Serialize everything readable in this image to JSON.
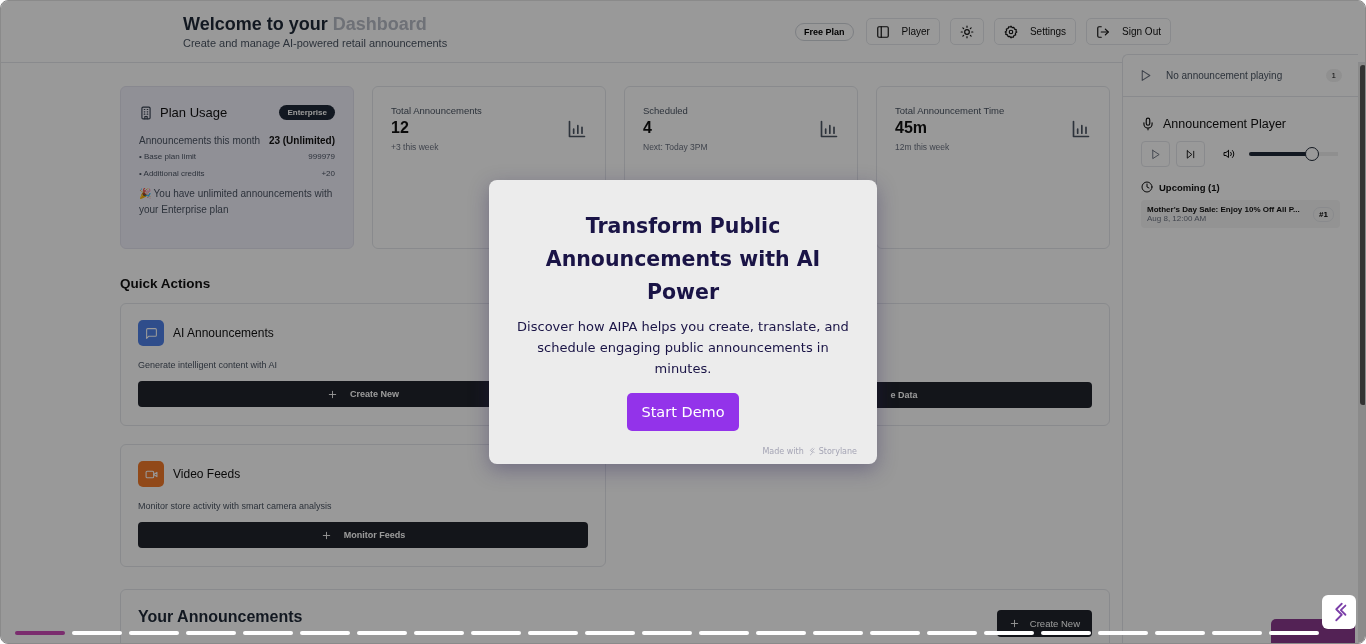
{
  "header": {
    "title_lead": "Welcome to your ",
    "title_tail": "Dashboard",
    "subtitle": "Create and manage AI-powered retail announcements",
    "plan_badge": "Free Plan",
    "buttons": [
      {
        "kind": "player",
        "label": "Player"
      },
      {
        "kind": "theme"
      },
      {
        "kind": "settings",
        "label": "Settings"
      },
      {
        "kind": "signout",
        "label": "Sign Out"
      }
    ]
  },
  "plan_usage": {
    "title": "Plan Usage",
    "badge": "Enterprise",
    "rows": [
      {
        "kind": "main",
        "label": "Announcements this month",
        "value": "23 (Unlimited)"
      },
      {
        "kind": "sub",
        "label": "• Base plan limit",
        "value": "999979"
      },
      {
        "kind": "sub",
        "label": "• Additional credits",
        "value": "+20"
      }
    ],
    "note": "🎉 You have unlimited announcements with your Enterprise plan"
  },
  "stats": [
    {
      "label": "Total Announcements",
      "value": "12",
      "detail": "+3 this week"
    },
    {
      "label": "Scheduled",
      "value": "4",
      "detail": "Next: Today 3PM"
    },
    {
      "label": "Total Announcement Time",
      "value": "45m",
      "detail": "12m this week"
    }
  ],
  "quick_actions": {
    "title": "Quick Actions",
    "cards": [
      {
        "kind": "chat",
        "title": "AI Announcements",
        "description": "Generate intelligent content with AI",
        "button": "Create New"
      },
      {
        "kind": "hidden",
        "button": "e Data"
      },
      {
        "kind": "video",
        "title": "Video Feeds",
        "description": "Monitor store activity with smart camera analysis",
        "button": "Monitor Feeds"
      }
    ]
  },
  "announcements": {
    "title": "Your Announcements",
    "button": "Create New"
  },
  "now_playing": {
    "text": "No announcement playing",
    "count": "1"
  },
  "player": {
    "title": "Announcement Player",
    "volume": {
      "level": 0.72
    },
    "upcoming_title": "Upcoming (1)",
    "upcoming": [
      {
        "title": "Mother's Day Sale: Enjoy 10% Off All P...",
        "time": "Aug 8, 12:00 AM",
        "badge": "#1"
      }
    ]
  },
  "modal": {
    "title": "Transform Public Announcements with AI Power",
    "text": "Discover how AIPA helps you create, translate, and schedule engaging public announcements in minutes.",
    "button": "Start Demo",
    "footer_lead": "Made with",
    "footer_brand": "Storylane"
  },
  "steps": [
    {
      "selected": true
    },
    {
      "selected": false
    },
    {
      "selected": false
    },
    {
      "selected": false
    },
    {
      "selected": false
    },
    {
      "selected": false
    },
    {
      "selected": false
    },
    {
      "selected": false
    },
    {
      "selected": false
    },
    {
      "selected": false
    },
    {
      "selected": false
    },
    {
      "selected": false
    },
    {
      "selected": false
    },
    {
      "selected": false
    },
    {
      "selected": false
    },
    {
      "selected": false
    },
    {
      "selected": false
    },
    {
      "selected": false
    },
    {
      "selected": false
    },
    {
      "selected": false
    },
    {
      "selected": false
    },
    {
      "selected": false
    },
    {
      "selected": false
    }
  ]
}
